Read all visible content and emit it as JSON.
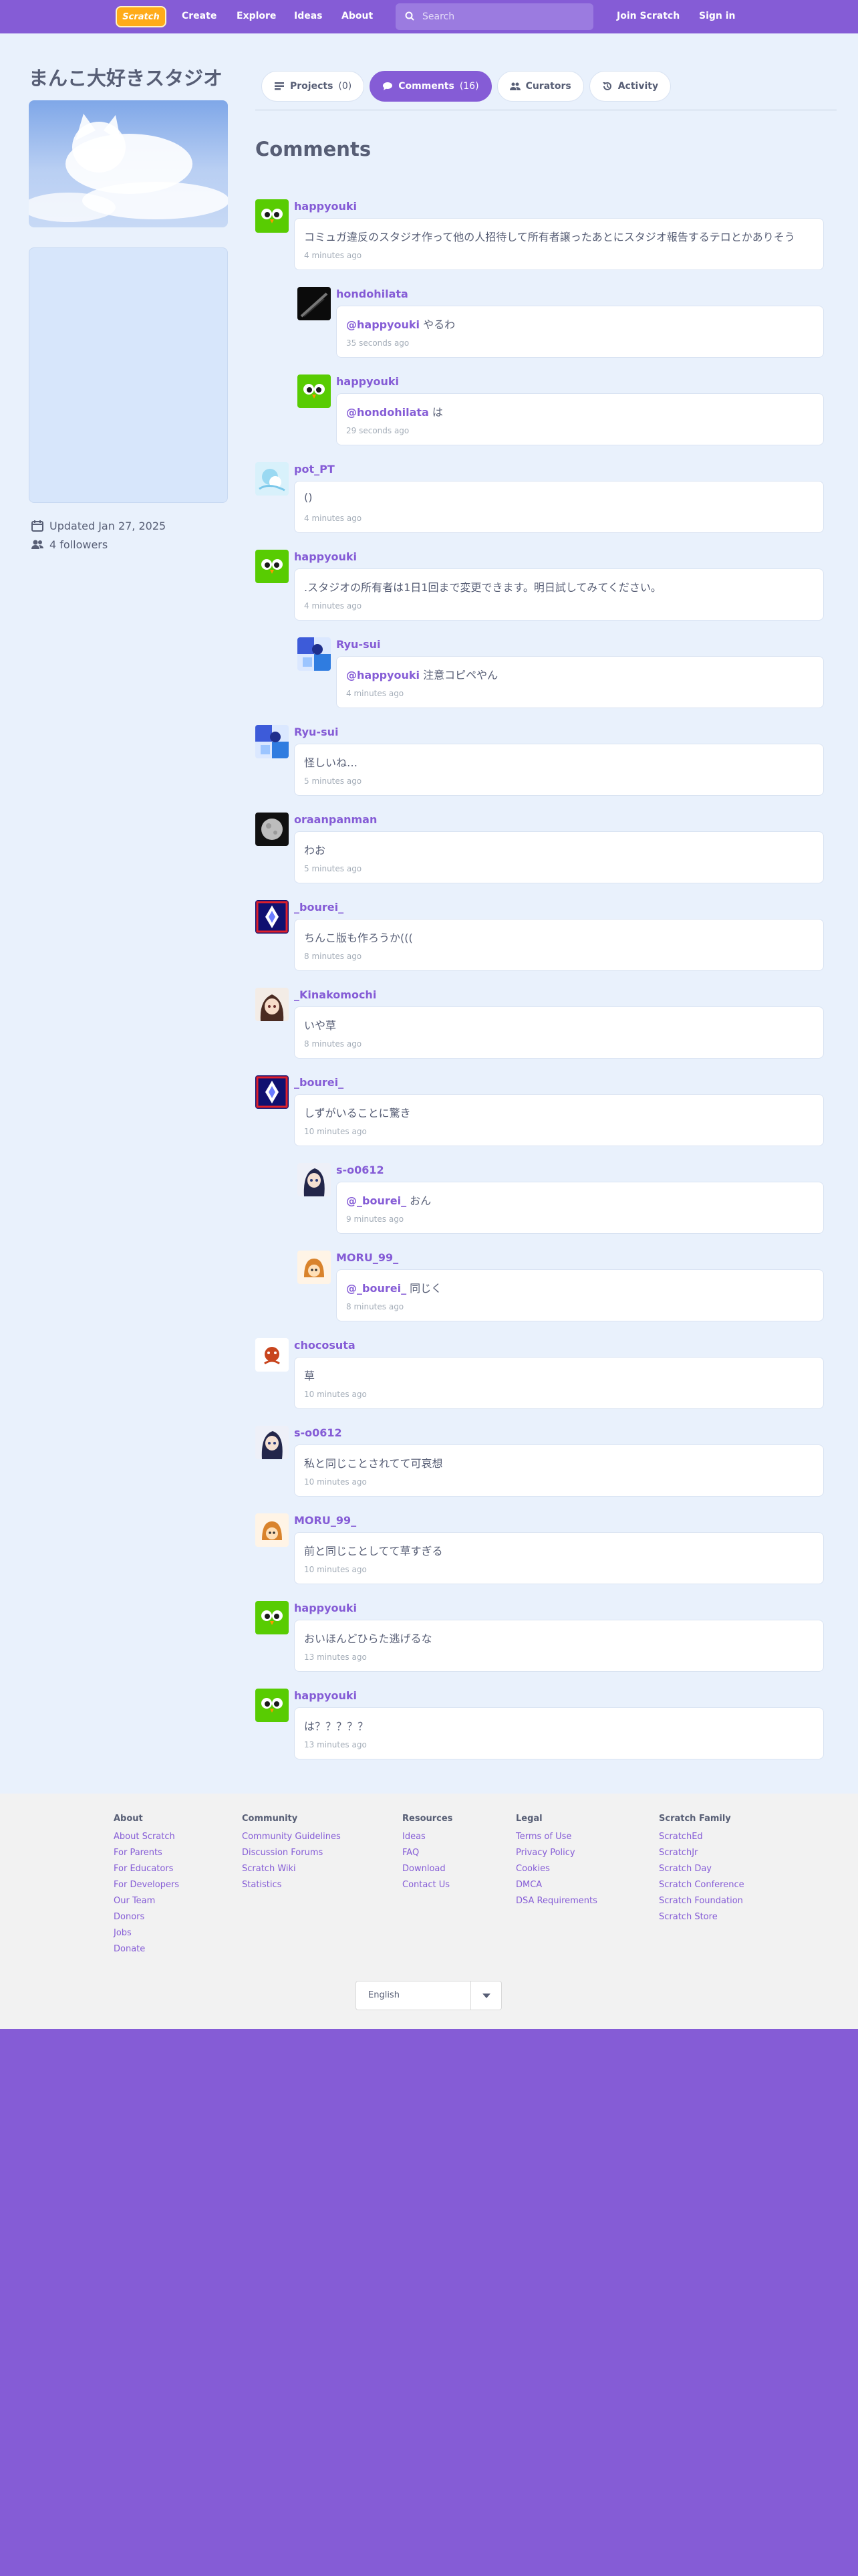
{
  "nav": {
    "logo": "Scratch",
    "links": [
      "Create",
      "Explore",
      "Ideas",
      "About"
    ],
    "search_placeholder": "Search",
    "join": "Join Scratch",
    "signin": "Sign in"
  },
  "studio": {
    "title": "まんこ大好きスタジオ",
    "updated": "Updated Jan 27, 2025",
    "followers": "4 followers"
  },
  "tabs": [
    {
      "label": "Projects",
      "count": "(0)"
    },
    {
      "label": "Comments",
      "count": "(16)"
    },
    {
      "label": "Curators",
      "count": ""
    },
    {
      "label": "Activity",
      "count": ""
    }
  ],
  "comments_heading": "Comments",
  "comments": [
    {
      "user": "happyouki",
      "mention": "",
      "text": "コミュガ違反のスタジオ作って他の人招待して所有者譲ったあとにスタジオ報告するテロとかありそう",
      "time": "4 minutes ago",
      "reply": false,
      "avatar": "green"
    },
    {
      "user": "hondohilata",
      "mention": "@happyouki",
      "text": " やるわ",
      "time": "35 seconds ago",
      "reply": true,
      "avatar": "dark"
    },
    {
      "user": "happyouki",
      "mention": "@hondohilata",
      "text": " は",
      "time": "29 seconds ago",
      "reply": true,
      "avatar": "green"
    },
    {
      "user": "pot_PT",
      "mention": "",
      "text": "()",
      "time": "4 minutes ago",
      "reply": false,
      "avatar": "light"
    },
    {
      "user": "happyouki",
      "mention": "",
      "text": ".スタジオの所有者は1日1回まで変更できます。明日試してみてください。",
      "time": "4 minutes ago",
      "reply": false,
      "avatar": "green"
    },
    {
      "user": "Ryu-sui",
      "mention": "@happyouki",
      "text": " 注意コピペやん",
      "time": "4 minutes ago",
      "reply": true,
      "avatar": "blue"
    },
    {
      "user": "Ryu-sui",
      "mention": "",
      "text": "怪しいね…",
      "time": "5 minutes ago",
      "reply": false,
      "avatar": "blue"
    },
    {
      "user": "oraanpanman",
      "mention": "",
      "text": "わお",
      "time": "5 minutes ago",
      "reply": false,
      "avatar": "moon"
    },
    {
      "user": "_bourei_",
      "mention": "",
      "text": "ちんこ版も作ろうか(((",
      "time": "8 minutes ago",
      "reply": false,
      "avatar": "diamond"
    },
    {
      "user": "_Kinakomochi",
      "mention": "",
      "text": "いや草",
      "time": "8 minutes ago",
      "reply": false,
      "avatar": "anime"
    },
    {
      "user": "_bourei_",
      "mention": "",
      "text": "しずがいることに驚き",
      "time": "10 minutes ago",
      "reply": false,
      "avatar": "diamond"
    },
    {
      "user": "s-o0612",
      "mention": "@_bourei_",
      "text": " おん",
      "time": "9 minutes ago",
      "reply": true,
      "avatar": "anime2"
    },
    {
      "user": "MORU_99_",
      "mention": "@_bourei_",
      "text": " 同じく",
      "time": "8 minutes ago",
      "reply": true,
      "avatar": "orange"
    },
    {
      "user": "chocosuta",
      "mention": "",
      "text": "草",
      "time": "10 minutes ago",
      "reply": false,
      "avatar": "red"
    },
    {
      "user": "s-o0612",
      "mention": "",
      "text": "私と同じことされてて可哀想",
      "time": "10 minutes ago",
      "reply": false,
      "avatar": "anime2"
    },
    {
      "user": "MORU_99_",
      "mention": "",
      "text": "前と同じことしてて草すぎる",
      "time": "10 minutes ago",
      "reply": false,
      "avatar": "orange"
    },
    {
      "user": "happyouki",
      "mention": "",
      "text": "おいほんどひらた逃げるな",
      "time": "13 minutes ago",
      "reply": false,
      "avatar": "green"
    },
    {
      "user": "happyouki",
      "mention": "",
      "text": "は？？？？？",
      "time": "13 minutes ago",
      "reply": false,
      "avatar": "green"
    }
  ],
  "footer": {
    "columns": [
      {
        "title": "About",
        "links": [
          "About Scratch",
          "For Parents",
          "For Educators",
          "For Developers",
          "Our Team",
          "Donors",
          "Jobs",
          "Donate"
        ]
      },
      {
        "title": "Community",
        "links": [
          "Community Guidelines",
          "Discussion Forums",
          "Scratch Wiki",
          "Statistics"
        ]
      },
      {
        "title": "Resources",
        "links": [
          "Ideas",
          "FAQ",
          "Download",
          "Contact Us"
        ]
      },
      {
        "title": "Legal",
        "links": [
          "Terms of Use",
          "Privacy Policy",
          "Cookies",
          "DMCA",
          "DSA Requirements"
        ]
      },
      {
        "title": "Scratch Family",
        "links": [
          "ScratchEd",
          "ScratchJr",
          "Scratch Day",
          "Scratch Conference",
          "Scratch Foundation",
          "Scratch Store"
        ]
      }
    ],
    "language": "English"
  },
  "colors": {
    "brand": "#855cd6",
    "background": "#e9f1fc",
    "accent_link": "#855cd6"
  }
}
